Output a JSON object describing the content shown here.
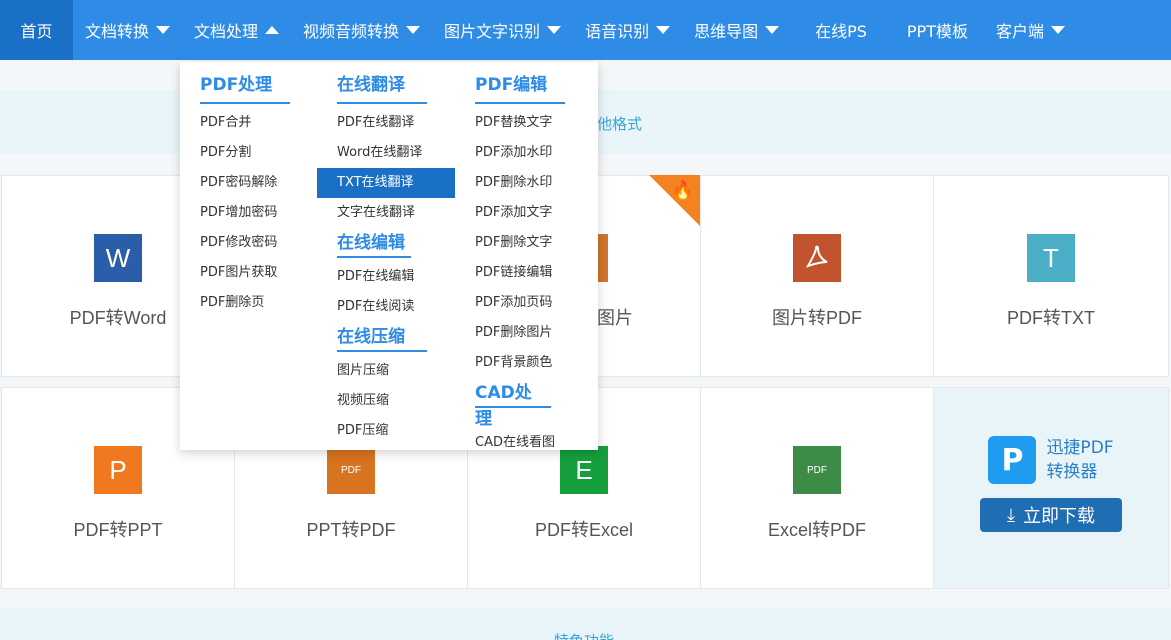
{
  "nav": {
    "items": [
      {
        "label": "首页",
        "caret": false
      },
      {
        "label": "文档转换",
        "caret": "down"
      },
      {
        "label": "文档处理",
        "caret": "up"
      },
      {
        "label": "视频音频转换",
        "caret": "down"
      },
      {
        "label": "图片文字识别",
        "caret": "down"
      },
      {
        "label": "语音识别",
        "caret": "down"
      },
      {
        "label": "思维导图",
        "caret": "down"
      },
      {
        "label": "在线PS",
        "caret": false
      },
      {
        "label": "PPT模板",
        "caret": false
      },
      {
        "label": "客户端",
        "caret": "down"
      }
    ]
  },
  "banner": {
    "text": "他格式"
  },
  "dropdown": {
    "col1": {
      "heading": "PDF处理",
      "links": [
        "PDF合并",
        "PDF分割",
        "PDF密码解除",
        "PDF增加密码",
        "PDF修改密码",
        "PDF图片获取",
        "PDF删除页"
      ]
    },
    "col2": {
      "heading1": "在线翻译",
      "links1": [
        "PDF在线翻译",
        "Word在线翻译",
        "TXT在线翻译",
        "文字在线翻译"
      ],
      "heading2": "在线编辑",
      "links2": [
        "PDF在线编辑",
        "PDF在线阅读"
      ],
      "heading3": "在线压缩",
      "links3": [
        "图片压缩",
        "视频压缩",
        "PDF压缩"
      ]
    },
    "col3": {
      "heading1": "PDF编辑",
      "links1": [
        "PDF替换文字",
        "PDF添加水印",
        "PDF删除水印",
        "PDF添加文字",
        "PDF删除文字",
        "PDF链接编辑",
        "PDF添加页码",
        "PDF删除图片",
        "PDF背景颜色"
      ],
      "heading2": "CAD处理",
      "links2": [
        "CAD在线看图"
      ]
    },
    "active_link": "TXT在线翻译"
  },
  "tools": {
    "row1": [
      {
        "label": "PDF转Word",
        "glyph": "W",
        "color": "#2b5ea8"
      },
      {
        "label": "",
        "glyph": "",
        "color": "#ffffff"
      },
      {
        "label": "图片",
        "glyph": "",
        "color": "#d0742c"
      },
      {
        "label": "图片转PDF",
        "glyph": "PDF",
        "color": "#c3532e"
      },
      {
        "label": "PDF转TXT",
        "glyph": "T",
        "color": "#4aaec6"
      }
    ],
    "row2": [
      {
        "label": "PDF转PPT",
        "glyph": "P",
        "color": "#f0781e"
      },
      {
        "label": "PPT转PDF",
        "glyph": "PDF",
        "color": "#d8731f"
      },
      {
        "label": "PDF转Excel",
        "glyph": "E",
        "color": "#159f3c"
      },
      {
        "label": "Excel转PDF",
        "glyph": "PDF",
        "color": "#3c8c48"
      }
    ]
  },
  "promo": {
    "title_line1": "迅捷PDF",
    "title_line2": "转换器",
    "download_label": "立即下载"
  },
  "bottom": {
    "text": "特色功能"
  },
  "colors": {
    "nav": "#2f8ce6",
    "nav_active": "#1a6fc6",
    "accent": "#2f8ce6",
    "hot": "#f58220"
  }
}
